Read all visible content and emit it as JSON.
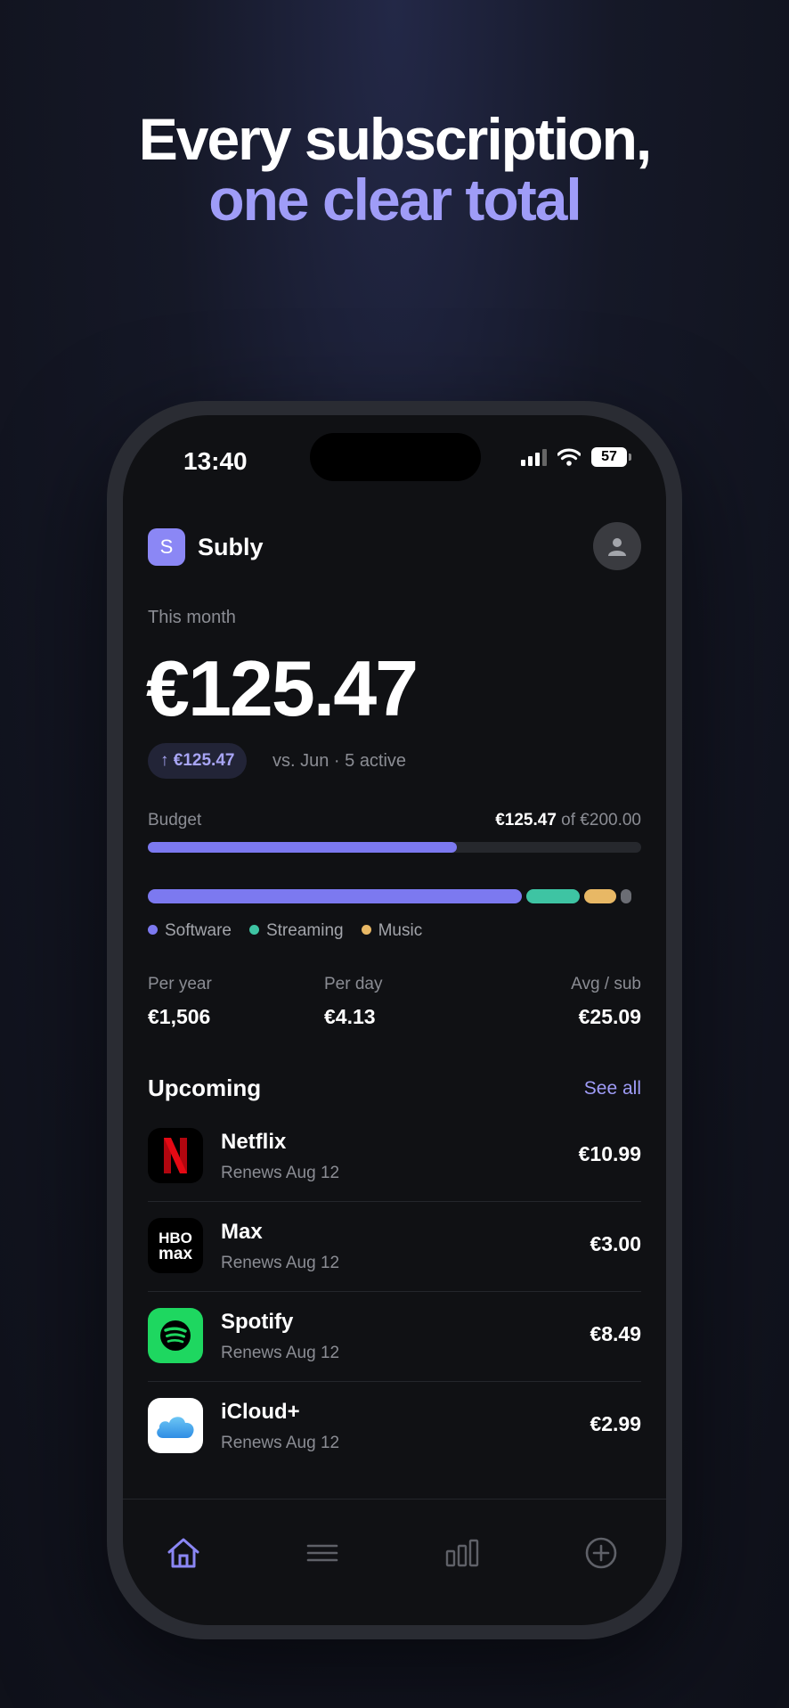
{
  "headline": {
    "line1": "Every subscription,",
    "line2": "one clear total"
  },
  "status_bar": {
    "time": "13:40",
    "battery": "57"
  },
  "app": {
    "logo_letter": "S",
    "name": "Subly"
  },
  "summary": {
    "period_label": "This month",
    "total": "€125.47",
    "change": "↑ €125.47",
    "comparison": "vs. Jun · 5 active"
  },
  "budget": {
    "label": "Budget",
    "spent": "€125.47",
    "of_total": " of €200.00",
    "fraction": 0.627
  },
  "categories": [
    {
      "name": "Software",
      "color": "#7c79f0",
      "fraction": 0.78
    },
    {
      "name": "Streaming",
      "color": "#3ec4a3",
      "fraction": 0.11
    },
    {
      "name": "Music",
      "color": "#e8b865",
      "fraction": 0.068
    },
    {
      "name": "",
      "color": "#6b6d74",
      "fraction": 0.022
    }
  ],
  "stats": [
    {
      "label": "Per year",
      "value": "€1,506"
    },
    {
      "label": "Per day",
      "value": "€4.13"
    },
    {
      "label": "Avg / sub",
      "value": "€25.09"
    }
  ],
  "upcoming": {
    "title": "Upcoming",
    "see_all": "See all",
    "items": [
      {
        "name": "Netflix",
        "renews": "Renews Aug 12",
        "price": "€10.99",
        "icon": "netflix-icon"
      },
      {
        "name": "Max",
        "renews": "Renews Aug 12",
        "price": "€3.00",
        "icon": "hbo-max-icon"
      },
      {
        "name": "Spotify",
        "renews": "Renews Aug 12",
        "price": "€8.49",
        "icon": "spotify-icon"
      },
      {
        "name": "iCloud+",
        "renews": "Renews Aug 12",
        "price": "€2.99",
        "icon": "icloud-icon"
      }
    ]
  },
  "tabs": [
    "home-icon",
    "list-icon",
    "chart-icon",
    "add-icon"
  ],
  "colors": {
    "accent": "#9f9cf7",
    "background": "#101114"
  }
}
